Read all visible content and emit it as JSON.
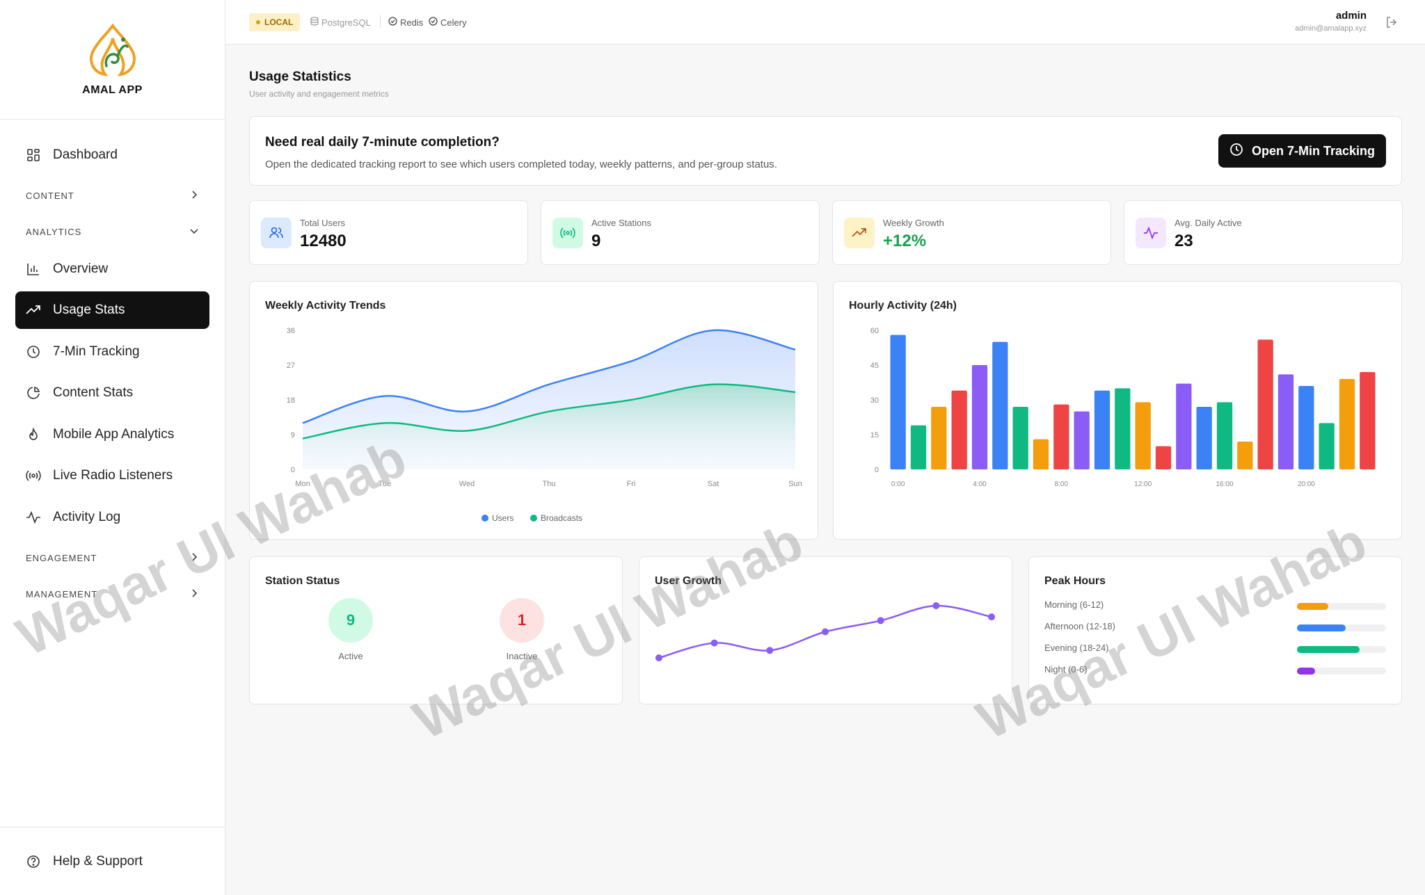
{
  "brand": {
    "name": "AMAL APP"
  },
  "sidebar": {
    "items": [
      {
        "label": "Dashboard",
        "icon": "grid-icon"
      },
      {
        "label": "Overview",
        "icon": "bar-chart-icon"
      },
      {
        "label": "Usage Stats",
        "icon": "trending-up-icon",
        "active": true
      },
      {
        "label": "7-Min Tracking",
        "icon": "clock-icon"
      },
      {
        "label": "Content Stats",
        "icon": "pie-chart-icon"
      },
      {
        "label": "Mobile App Analytics",
        "icon": "flame-icon"
      },
      {
        "label": "Live Radio Listeners",
        "icon": "radio-icon"
      },
      {
        "label": "Activity Log",
        "icon": "activity-icon"
      }
    ],
    "sections": {
      "content": "CONTENT",
      "analytics": "ANALYTICS",
      "engagement": "ENGAGEMENT",
      "management": "MANAGEMENT"
    },
    "help": "Help & Support"
  },
  "topbar": {
    "env": "LOCAL",
    "services": [
      "PostgreSQL",
      "Redis",
      "Celery"
    ],
    "user_name": "admin",
    "user_email": "admin@amalapp.xyz"
  },
  "page": {
    "title": "Usage Statistics",
    "subtitle": "User activity and engagement metrics"
  },
  "banner": {
    "title": "Need real daily 7-minute completion?",
    "text": "Open the dedicated tracking report to see which users completed today, weekly patterns, and per-group status.",
    "button": "Open 7-Min Tracking"
  },
  "stats": [
    {
      "label": "Total Users",
      "value": "12480",
      "icon": "users-icon",
      "accent": "#2563eb",
      "bg": "#dbeafe"
    },
    {
      "label": "Active Stations",
      "value": "9",
      "icon": "broadcast-icon",
      "accent": "#10b981",
      "bg": "#d1fae5"
    },
    {
      "label": "Weekly Growth",
      "value": "+12%",
      "icon": "trending-up-icon",
      "accent": "#b45309",
      "bg": "#fef3c7",
      "value_color": "#16a34a"
    },
    {
      "label": "Avg. Daily Active",
      "value": "23",
      "icon": "activity-icon",
      "accent": "#9333ea",
      "bg": "#f3e8ff"
    }
  ],
  "weekly": {
    "title": "Weekly Activity Trends",
    "legend_users": "Users",
    "legend_broadcasts": "Broadcasts"
  },
  "hourly": {
    "title": "Hourly Activity (24h)"
  },
  "station_status": {
    "title": "Station Status",
    "active_value": "9",
    "active_label": "Active",
    "inactive_value": "1",
    "inactive_label": "Inactive"
  },
  "user_growth": {
    "title": "User Growth"
  },
  "peak_hours": {
    "title": "Peak Hours",
    "rows": [
      {
        "label": "Morning (6-12)",
        "value": 0.35,
        "color": "#f59e0b"
      },
      {
        "label": "Afternoon (12-18)",
        "value": 0.55,
        "color": "#3b82f6"
      },
      {
        "label": "Evening (18-24)",
        "value": 0.7,
        "color": "#10b981"
      },
      {
        "label": "Night (0-6)",
        "value": 0.2,
        "color": "#9333ea"
      }
    ]
  },
  "watermark": {
    "text": "Waqar Ul Wahab"
  },
  "chart_data": [
    {
      "type": "area",
      "title": "Weekly Activity Trends",
      "categories": [
        "Mon",
        "Tue",
        "Wed",
        "Thu",
        "Fri",
        "Sat",
        "Sun"
      ],
      "yticks": [
        0,
        9,
        18,
        27,
        36
      ],
      "ylim": [
        0,
        36
      ],
      "series": [
        {
          "name": "Users",
          "color": "#3b82f6",
          "values": [
            12,
            19,
            15,
            22,
            28,
            36,
            31
          ]
        },
        {
          "name": "Broadcasts",
          "color": "#10b981",
          "values": [
            8,
            12,
            10,
            15,
            18,
            22,
            20
          ]
        }
      ],
      "legend": "bottom"
    },
    {
      "type": "bar",
      "title": "Hourly Activity (24h)",
      "categories": [
        "0:00",
        "1:00",
        "2:00",
        "3:00",
        "4:00",
        "5:00",
        "6:00",
        "7:00",
        "8:00",
        "9:00",
        "10:00",
        "11:00",
        "12:00",
        "13:00",
        "14:00",
        "15:00",
        "16:00",
        "17:00",
        "18:00",
        "19:00",
        "20:00",
        "21:00",
        "22:00",
        "23:00"
      ],
      "xtick_labels": [
        "0:00",
        "4:00",
        "8:00",
        "12:00",
        "16:00",
        "20:00"
      ],
      "yticks": [
        0,
        15,
        30,
        45,
        60
      ],
      "ylim": [
        0,
        60
      ],
      "values": [
        58,
        19,
        27,
        34,
        45,
        55,
        27,
        13,
        28,
        25,
        34,
        35,
        29,
        10,
        37,
        27,
        29,
        12,
        56,
        41,
        36,
        20,
        39,
        42
      ],
      "colors": [
        "#3b82f6",
        "#10b981",
        "#f59e0b",
        "#ef4444",
        "#8b5cf6"
      ]
    },
    {
      "type": "line",
      "title": "User Growth",
      "values": [
        100,
        120,
        110,
        135,
        150,
        170,
        155
      ],
      "color": "#8b5cf6"
    }
  ]
}
